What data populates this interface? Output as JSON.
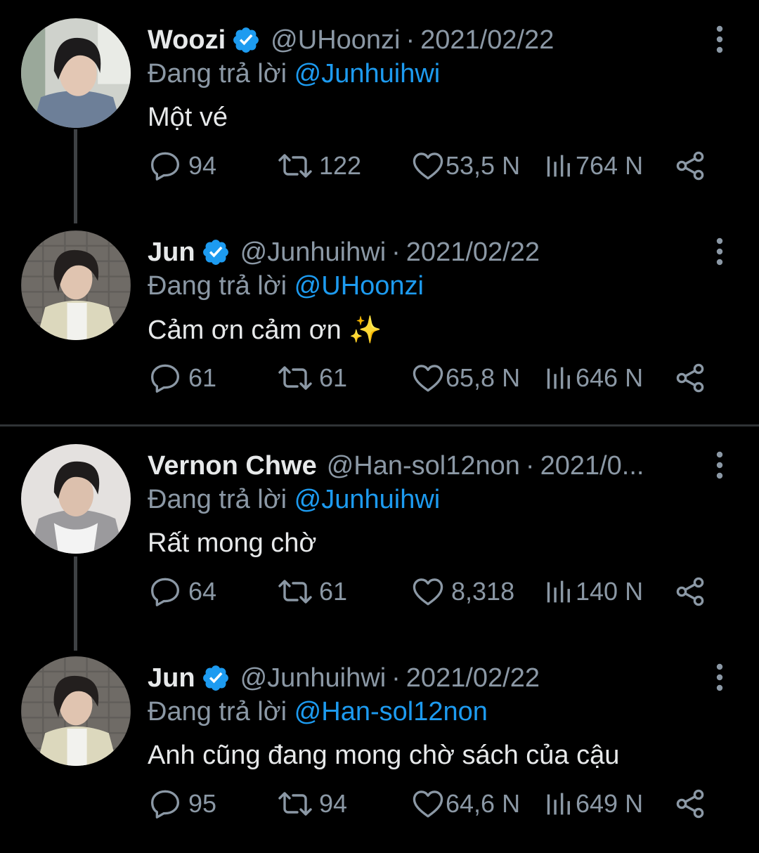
{
  "colors": {
    "background": "#000000",
    "text": "#e7e9ea",
    "muted": "#8b98a5",
    "mention": "#1d9bf0",
    "verified": "#1d9bf0"
  },
  "tweets": [
    {
      "name": "Woozi",
      "handle": "@UHoonzi",
      "sep": "·",
      "date": "2021/02/22",
      "reply_prefix": "Đang trả lời ",
      "reply_to": "@Junhuihwi",
      "text": "Một vé",
      "replies": "94",
      "retweets": "122",
      "likes": "53,5 N",
      "views": "764 N",
      "avatar_icon": "avatar-woozi",
      "verified": true
    },
    {
      "name": "Jun",
      "handle": "@Junhuihwi",
      "sep": "·",
      "date": "2021/02/22",
      "reply_prefix": "Đang trả lời ",
      "reply_to": "@UHoonzi",
      "text": "Cảm ơn cảm ơn ✨",
      "replies": "61",
      "retweets": "61",
      "likes": "65,8 N",
      "views": "646 N",
      "avatar_icon": "avatar-jun",
      "verified": true
    },
    {
      "name": "Vernon Chwe",
      "handle": "@Han-sol12non",
      "sep": "·",
      "date": "2021/0...",
      "reply_prefix": "Đang trả lời ",
      "reply_to": "@Junhuihwi",
      "text": "Rất mong chờ",
      "replies": "64",
      "retweets": "61",
      "likes": "8,318",
      "views": "140 N",
      "avatar_icon": "avatar-vernon",
      "verified": false
    },
    {
      "name": "Jun",
      "handle": "@Junhuihwi",
      "sep": "·",
      "date": "2021/02/22",
      "reply_prefix": "Đang trả lời ",
      "reply_to": "@Han-sol12non",
      "text": "Anh cũng đang mong chờ sách của cậu",
      "replies": "95",
      "retweets": "94",
      "likes": "64,6 N",
      "views": "649 N",
      "avatar_icon": "avatar-jun",
      "verified": true
    }
  ]
}
